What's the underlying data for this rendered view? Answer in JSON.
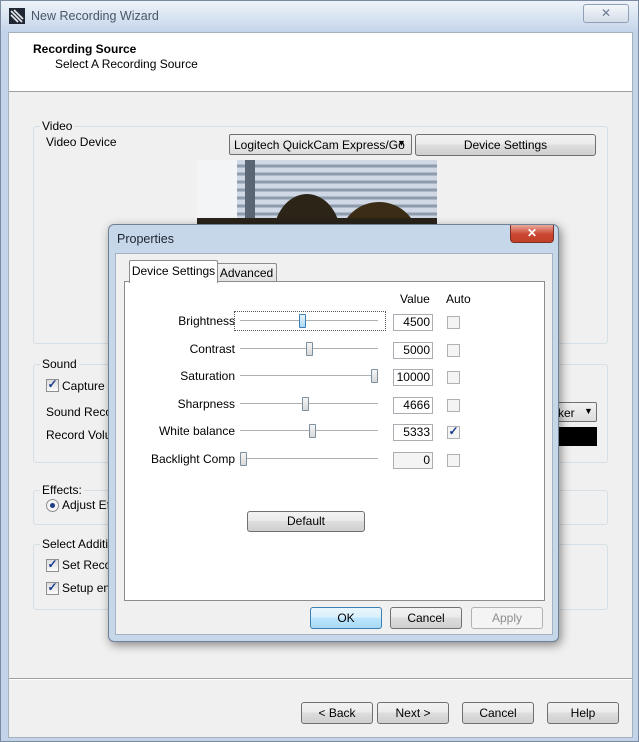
{
  "wizard": {
    "title": "New Recording Wizard",
    "close_glyph": "✕",
    "header_title": "Recording Source",
    "header_subtitle": "Select A Recording Source"
  },
  "video": {
    "group_label": "Video",
    "device_label": "Video Device",
    "device_value": "Logitech QuickCam Express/Go",
    "device_settings_button": "Device Settings"
  },
  "sound": {
    "group_label": "Sound",
    "capture_label": "Capture S",
    "capture_checked": true,
    "recorder_label": "Sound Recor",
    "volume_label": "Record Volum",
    "combo_visible_text": "ker"
  },
  "effects": {
    "group_label": "Effects:",
    "adjust_label": "Adjust Effe",
    "adjust_selected": true
  },
  "additional": {
    "group_label": "Select Additio",
    "set_record_label": "Set Recor",
    "set_record_checked": true,
    "setup_end_label": "Setup end",
    "setup_end_checked": true
  },
  "footer": {
    "back": "< Back",
    "next": "Next >",
    "cancel": "Cancel",
    "help": "Help"
  },
  "properties": {
    "title": "Properties",
    "close_glyph": "✕",
    "tabs": [
      "Device Settings",
      "Advanced"
    ],
    "active_tab": "Device Settings",
    "col_value": "Value",
    "col_auto": "Auto",
    "rows": [
      {
        "label": "Brightness",
        "value": "4500",
        "auto": false,
        "position_fraction": 0.45
      },
      {
        "label": "Contrast",
        "value": "5000",
        "auto": false,
        "position_fraction": 0.5
      },
      {
        "label": "Saturation",
        "value": "10000",
        "auto": false,
        "position_fraction": 1.0
      },
      {
        "label": "Sharpness",
        "value": "4666",
        "auto": false,
        "position_fraction": 0.47
      },
      {
        "label": "White balance",
        "value": "5333",
        "auto": true,
        "position_fraction": 0.53
      },
      {
        "label": "Backlight Comp",
        "value": "0",
        "auto": false,
        "position_fraction": 0.0
      }
    ],
    "default_button": "Default",
    "ok": "OK",
    "cancel": "Cancel",
    "apply": "Apply"
  }
}
